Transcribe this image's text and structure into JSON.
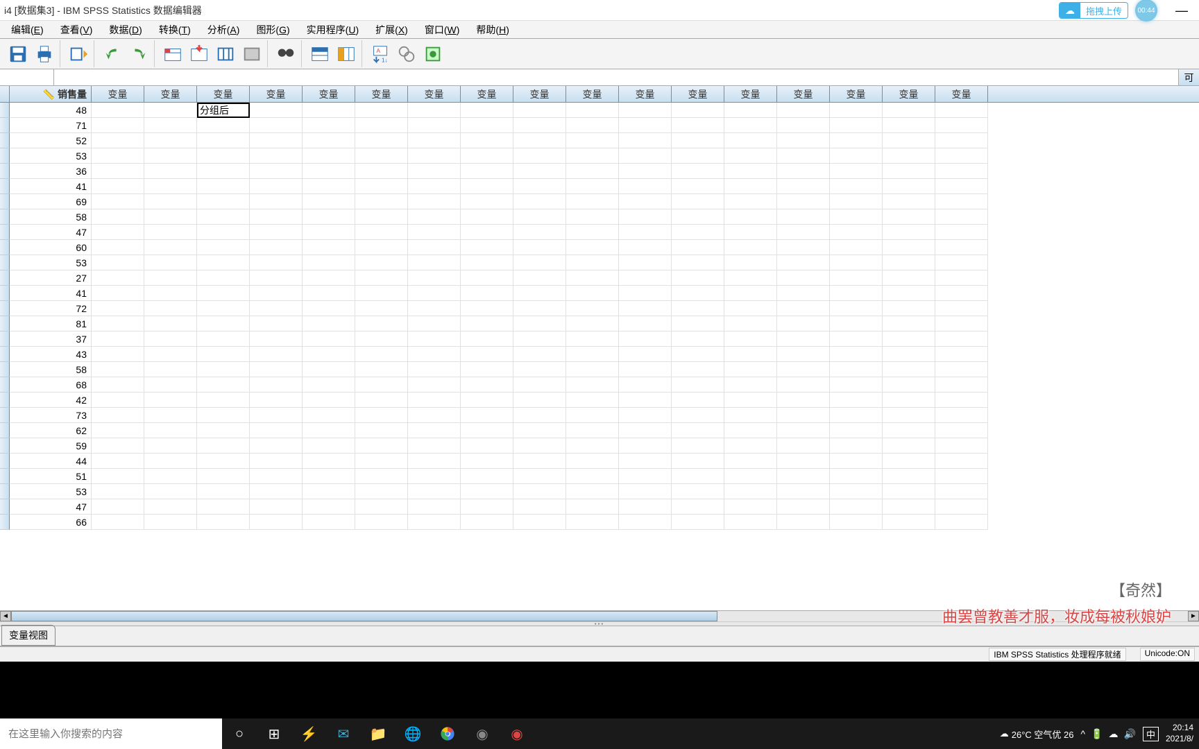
{
  "titlebar": {
    "title": "i4 [数据集3] - IBM SPSS Statistics 数据编辑器",
    "cloud_upload": "拖拽上传",
    "timer": "00:44"
  },
  "menu": {
    "items": [
      "编辑(E)",
      "查看(V)",
      "数据(D)",
      "转换(T)",
      "分析(A)",
      "图形(G)",
      "实用程序(U)",
      "扩展(X)",
      "窗口(W)",
      "帮助(H)"
    ]
  },
  "formula": {
    "visible_label": "可"
  },
  "grid": {
    "col1_header": "销售量",
    "var_label": "变量",
    "editing_value": "分组后",
    "data": [
      48,
      71,
      52,
      53,
      36,
      41,
      69,
      58,
      47,
      60,
      53,
      27,
      41,
      72,
      81,
      37,
      43,
      58,
      68,
      42,
      73,
      62,
      59,
      44,
      51,
      53,
      47,
      66
    ]
  },
  "view_tabs": {
    "variable_view": "变量视图"
  },
  "statusbar": {
    "processor": "IBM SPSS Statistics 处理程序就绪",
    "unicode": "Unicode:ON"
  },
  "taskbar": {
    "search_placeholder": "在这里输入你搜索的内容",
    "weather": "26°C 空气优 26",
    "ime": "中",
    "time": "20:14",
    "date": "2021/8/"
  },
  "subtitle": {
    "line1": "【奇然】",
    "line2": "曲罢曾教善才服，妆成每被秋娘妒"
  }
}
